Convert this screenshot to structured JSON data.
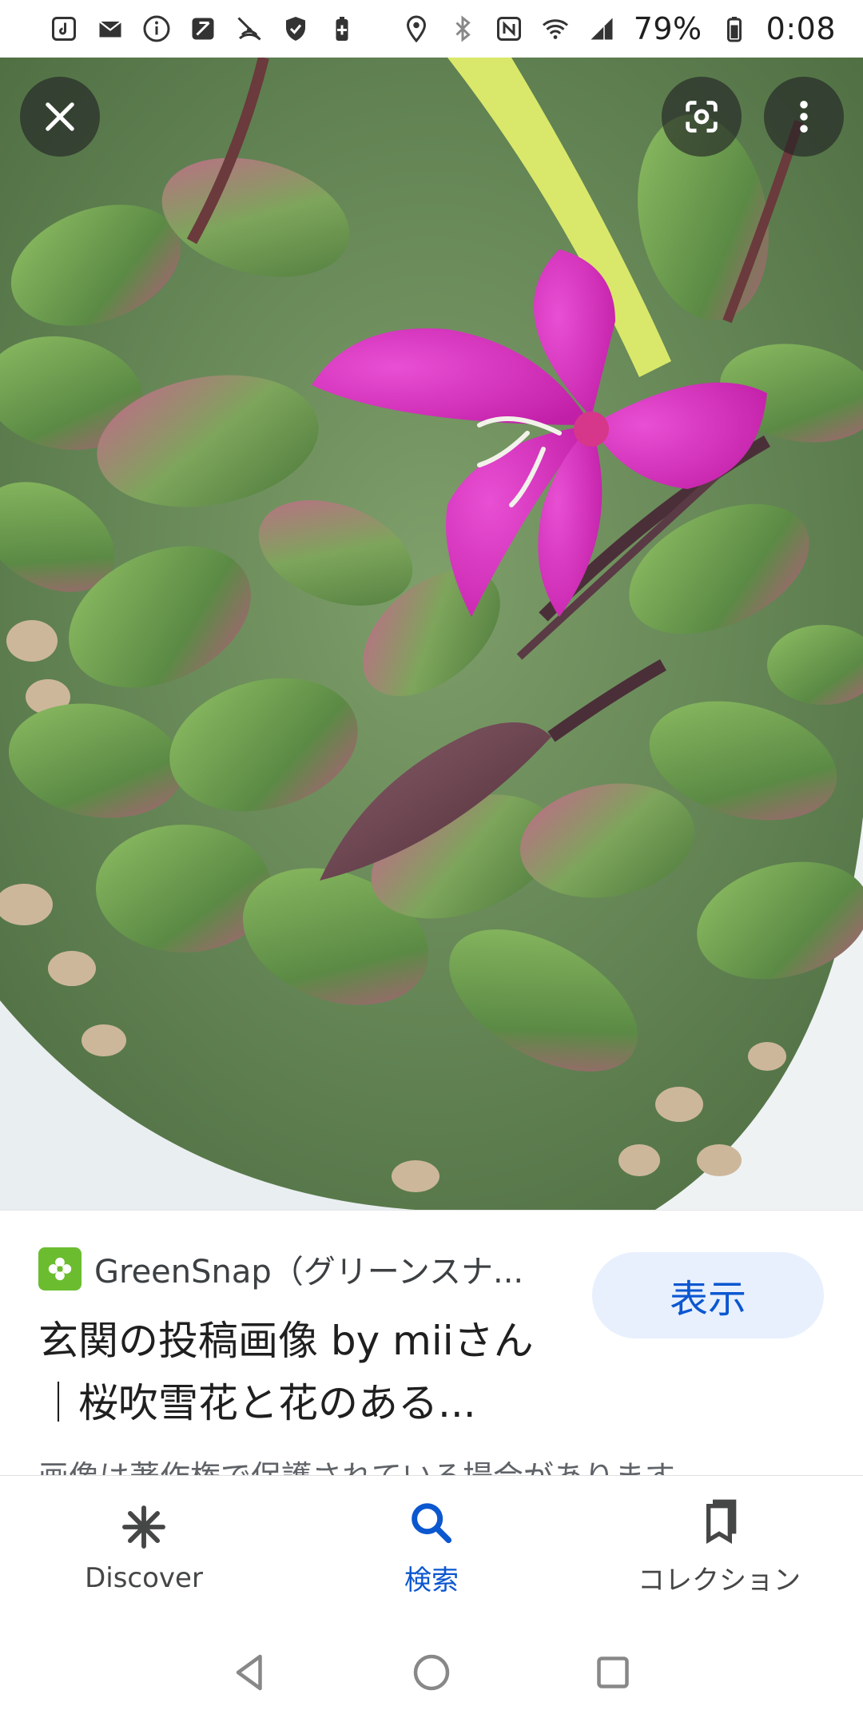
{
  "status_bar": {
    "battery": "79%",
    "time": "0:08"
  },
  "viewer": {
    "close_icon": "close-icon",
    "lens_icon": "lens-icon",
    "more_icon": "more-vertical-icon"
  },
  "result": {
    "source_name": "GreenSnap（グリーンスナ...",
    "view_button_label": "表示",
    "title": "玄関の投稿画像 by miiさん｜桜吹雪花と花のある...",
    "copyright_notice": "画像は著作権で保護されている場合があります"
  },
  "bottom_nav": {
    "items": [
      {
        "label": "Discover",
        "icon": "asterisk-icon"
      },
      {
        "label": "検索",
        "icon": "search-icon"
      },
      {
        "label": "コレクション",
        "icon": "collections-icon"
      }
    ]
  },
  "colors": {
    "accent": "#0b57d0",
    "button_bg": "#e8f0fe",
    "favicon": "#6bbd2f"
  }
}
